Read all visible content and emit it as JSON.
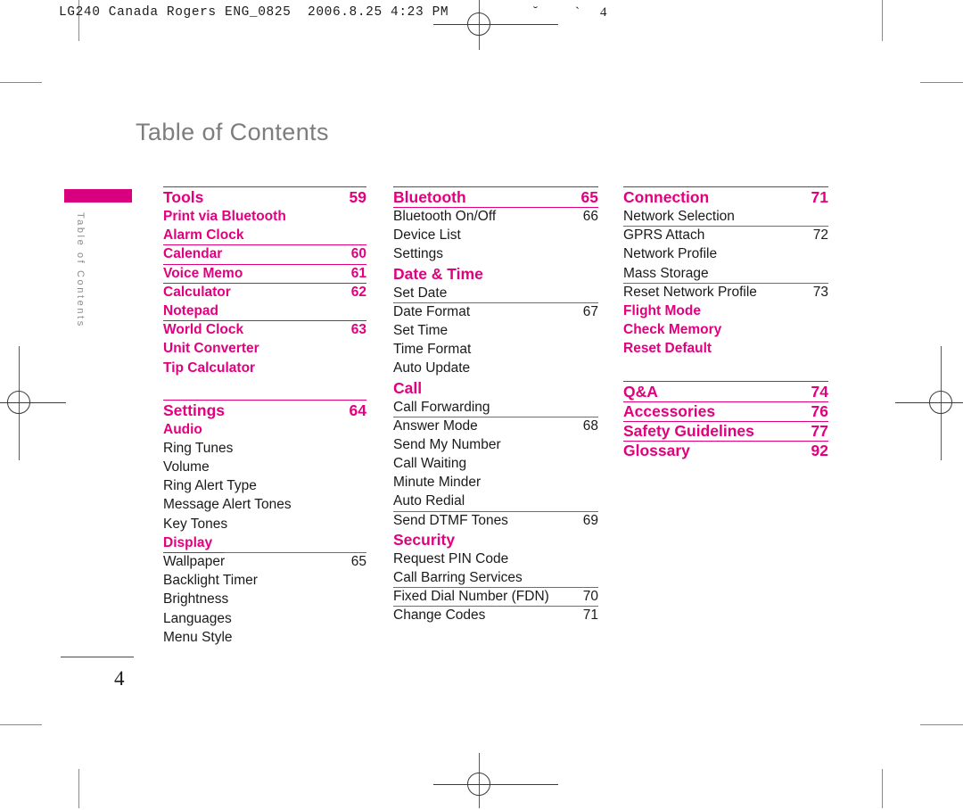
{
  "print_header": {
    "text": "LG240 Canada Rogers ENG_0825  2006.8.25 4:23 PM",
    "tick1": "˘",
    "tick2": "`",
    "tick3": "4"
  },
  "page": {
    "title": "Table of Contents",
    "side_tab_label": "Table of Contents",
    "number": "4"
  },
  "columns": [
    {
      "id": "column-1",
      "entries": [
        {
          "label": "Tools",
          "page": "59",
          "style": "pink",
          "head": true,
          "rule_top": "pink",
          "rule": "none"
        },
        {
          "label": "Print via Bluetooth",
          "page": "",
          "style": "pink",
          "head": false,
          "rule": "none"
        },
        {
          "label": "Alarm Clock",
          "page": "",
          "style": "pink",
          "head": false,
          "rule": "pink"
        },
        {
          "label": "Calendar",
          "page": "60",
          "style": "pink",
          "head": false,
          "rule": "pink"
        },
        {
          "label": "Voice Memo",
          "page": "61",
          "style": "pink",
          "head": false,
          "rule": "pink"
        },
        {
          "label": "Calculator",
          "page": "62",
          "style": "pink",
          "head": false,
          "rule": "none"
        },
        {
          "label": "Notepad",
          "page": "",
          "style": "pink",
          "head": false,
          "rule": "pink"
        },
        {
          "label": "World Clock",
          "page": "63",
          "style": "pink",
          "head": false,
          "rule": "none"
        },
        {
          "label": "Unit Converter",
          "page": "",
          "style": "pink",
          "head": false,
          "rule": "none"
        },
        {
          "label": "Tip Calculator",
          "page": "",
          "style": "pink",
          "head": false,
          "rule": "none"
        },
        {
          "gap": "large"
        },
        {
          "label": "Settings",
          "page": "64",
          "style": "pink",
          "head": true,
          "rule_top": "pink",
          "rule": "none"
        },
        {
          "label": "Audio",
          "page": "",
          "style": "pink",
          "head": false,
          "rule": "none"
        },
        {
          "label": "Ring Tunes",
          "page": "",
          "style": "black",
          "head": false,
          "rule": "none"
        },
        {
          "label": "Volume",
          "page": "",
          "style": "black",
          "head": false,
          "rule": "none"
        },
        {
          "label": "Ring Alert Type",
          "page": "",
          "style": "black",
          "head": false,
          "rule": "none"
        },
        {
          "label": "Message Alert Tones",
          "page": "",
          "style": "black",
          "head": false,
          "rule": "none"
        },
        {
          "label": "Key Tones",
          "page": "",
          "style": "black",
          "head": false,
          "rule": "none"
        },
        {
          "label": "Display",
          "page": "",
          "style": "pink",
          "head": false,
          "rule": "split"
        },
        {
          "label": "Wallpaper",
          "page": "65",
          "style": "black",
          "head": false,
          "rule": "none"
        },
        {
          "label": "Backlight Timer",
          "page": "",
          "style": "black",
          "head": false,
          "rule": "none"
        },
        {
          "label": "Brightness",
          "page": "",
          "style": "black",
          "head": false,
          "rule": "none"
        },
        {
          "label": "Languages",
          "page": "",
          "style": "black",
          "head": false,
          "rule": "none"
        },
        {
          "label": "Menu Style",
          "page": "",
          "style": "black",
          "head": false,
          "rule": "none"
        }
      ]
    },
    {
      "id": "column-2",
      "entries": [
        {
          "label": "Bluetooth",
          "page": "65",
          "style": "pink",
          "head": true,
          "rule_top": "pink",
          "rule": "pink"
        },
        {
          "label": "Bluetooth On/Off",
          "page": "66",
          "style": "black",
          "head": false,
          "rule": "none"
        },
        {
          "label": "Device List",
          "page": "",
          "style": "black",
          "head": false,
          "rule": "none"
        },
        {
          "label": "Settings",
          "page": "",
          "style": "black",
          "head": false,
          "rule": "none"
        },
        {
          "label": "Date & Time",
          "page": "",
          "style": "pink",
          "head": true,
          "rule": "none"
        },
        {
          "label": "Set Date",
          "page": "",
          "style": "black",
          "head": false,
          "rule": "gray"
        },
        {
          "label": "Date Format",
          "page": "67",
          "style": "black",
          "head": false,
          "rule": "none"
        },
        {
          "label": "Set Time",
          "page": "",
          "style": "black",
          "head": false,
          "rule": "none"
        },
        {
          "label": "Time Format",
          "page": "",
          "style": "black",
          "head": false,
          "rule": "none"
        },
        {
          "label": "Auto Update",
          "page": "",
          "style": "black",
          "head": false,
          "rule": "none"
        },
        {
          "label": "Call",
          "page": "",
          "style": "pink",
          "head": true,
          "rule": "none"
        },
        {
          "label": "Call Forwarding",
          "page": "",
          "style": "black",
          "head": false,
          "rule": "gray"
        },
        {
          "label": "Answer Mode",
          "page": "68",
          "style": "black",
          "head": false,
          "rule": "none"
        },
        {
          "label": "Send My Number",
          "page": "",
          "style": "black",
          "head": false,
          "rule": "none"
        },
        {
          "label": "Call Waiting",
          "page": "",
          "style": "black",
          "head": false,
          "rule": "none"
        },
        {
          "label": "Minute Minder",
          "page": "",
          "style": "black",
          "head": false,
          "rule": "none"
        },
        {
          "label": "Auto Redial",
          "page": "",
          "style": "black",
          "head": false,
          "rule": "gray"
        },
        {
          "label": "Send DTMF Tones",
          "page": "69",
          "style": "black",
          "head": false,
          "rule": "none"
        },
        {
          "label": "Security",
          "page": "",
          "style": "pink",
          "head": true,
          "rule": "none"
        },
        {
          "label": "Request PIN Code",
          "page": "",
          "style": "black",
          "head": false,
          "rule": "none"
        },
        {
          "label": "Call Barring Services",
          "page": "",
          "style": "black",
          "head": false,
          "rule": "gray"
        },
        {
          "label": "Fixed Dial Number (FDN)",
          "page": "70",
          "style": "black",
          "head": false,
          "rule": "gray"
        },
        {
          "label": "Change Codes",
          "page": "71",
          "style": "black",
          "head": false,
          "rule": "none"
        }
      ]
    },
    {
      "id": "column-3",
      "entries": [
        {
          "label": "Connection",
          "page": "71",
          "style": "pink",
          "head": true,
          "rule_top": "pink",
          "rule": "none"
        },
        {
          "label": "Network Selection",
          "page": "",
          "style": "black",
          "head": false,
          "rule": "gray"
        },
        {
          "label": "GPRS Attach",
          "page": "72",
          "style": "black",
          "head": false,
          "rule": "none"
        },
        {
          "label": "Network Profile",
          "page": "",
          "style": "black",
          "head": false,
          "rule": "none"
        },
        {
          "label": "Mass Storage",
          "page": "",
          "style": "black",
          "head": false,
          "rule": "gray"
        },
        {
          "label": "Reset Network Profile",
          "page": "73",
          "style": "black",
          "head": false,
          "rule": "none"
        },
        {
          "label": "Flight Mode",
          "page": "",
          "style": "pink",
          "head": false,
          "rule": "none"
        },
        {
          "label": "Check Memory",
          "page": "",
          "style": "pink",
          "head": false,
          "rule": "none"
        },
        {
          "label": "Reset Default",
          "page": "",
          "style": "pink",
          "head": false,
          "rule": "none"
        },
        {
          "gap": "large"
        },
        {
          "label": "Q&A",
          "page": "74",
          "style": "pink",
          "head": true,
          "rule_top": "pink",
          "rule": "pink"
        },
        {
          "label": "Accessories",
          "page": "76",
          "style": "pink",
          "head": true,
          "rule": "pink"
        },
        {
          "label": "Safety Guidelines",
          "page": "77",
          "style": "pink",
          "head": true,
          "rule": "pink"
        },
        {
          "label": "Glossary",
          "page": "92",
          "style": "pink",
          "head": true,
          "rule": "none"
        }
      ]
    }
  ],
  "colors": {
    "accent_pink": "#e2007f",
    "tab_pink": "#d9007f",
    "title_gray": "#7d7d7d",
    "rule_gray": "#6f6f6f",
    "text_black": "#1a1a1a"
  }
}
